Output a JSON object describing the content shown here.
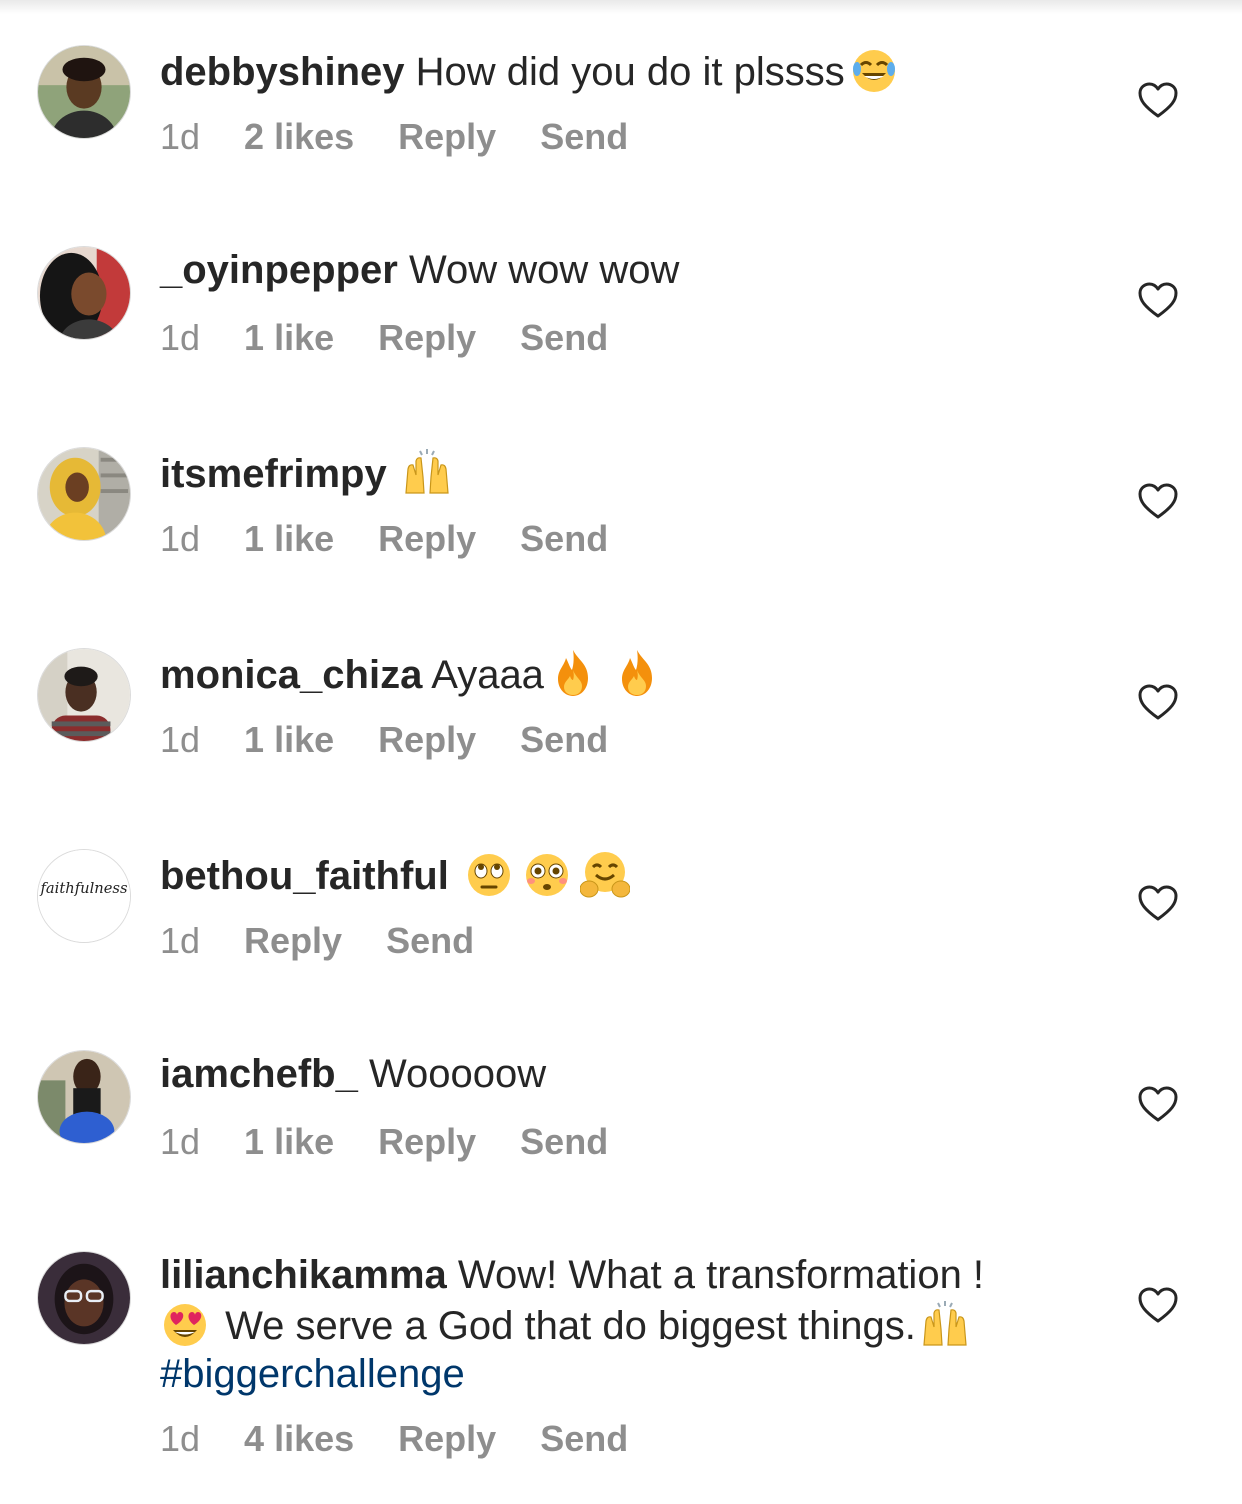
{
  "comments": [
    {
      "username": "debbyshiney",
      "text": "How did you do it plssss",
      "time": "1d",
      "likes": "2 likes",
      "reply": "Reply",
      "send": "Send"
    },
    {
      "username": "_oyinpepper",
      "text": "Wow wow wow",
      "time": "1d",
      "likes": "1 like",
      "reply": "Reply",
      "send": "Send"
    },
    {
      "username": "itsmefrimpy",
      "text": "",
      "time": "1d",
      "likes": "1 like",
      "reply": "Reply",
      "send": "Send"
    },
    {
      "username": "monica_chiza",
      "text": "Ayaaa",
      "time": "1d",
      "likes": "1 like",
      "reply": "Reply",
      "send": "Send"
    },
    {
      "username": "bethou_faithful",
      "text": "",
      "time": "1d",
      "reply": "Reply",
      "send": "Send",
      "avatar_text": "faithfulness"
    },
    {
      "username": "iamchefb_",
      "text": "Wooooow",
      "time": "1d",
      "likes": "1 like",
      "reply": "Reply",
      "send": "Send"
    },
    {
      "username": "lilianchikamma",
      "text_1": "Wow! What a transformation !",
      "text_2": "We serve a God that do biggest things.",
      "hashtag": "#biggerchallenge",
      "time": "1d",
      "likes": "4 likes",
      "reply": "Reply",
      "send": "Send"
    }
  ],
  "colors": {
    "username": "#262626",
    "meta": "#8e8e8e",
    "hashtag": "#00376b",
    "heart": "#262626"
  },
  "icons": [
    "heart-outline-icon",
    "tears-of-joy-emoji",
    "raising-hands-emoji",
    "fire-emoji",
    "rolling-eyes-emoji",
    "flushed-face-emoji",
    "hugging-face-emoji",
    "heart-eyes-emoji"
  ]
}
